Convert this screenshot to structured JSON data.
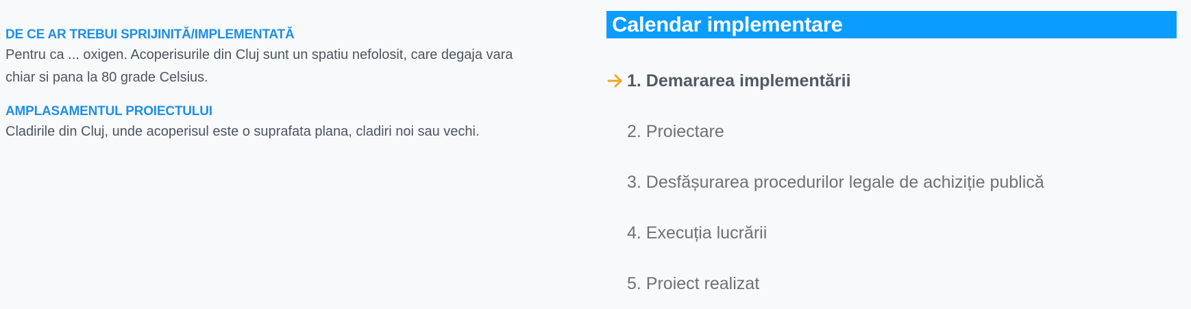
{
  "left": {
    "sections": [
      {
        "heading": "DE CE AR TREBUI SPRIJINITĂ/IMPLEMENTATĂ",
        "text_lines": [
          "Pentru ca ... oxigen. Acoperisurile din Cluj sunt un spatiu nefolosit, care degaja vara",
          "chiar si pana la 80 grade Celsius."
        ]
      },
      {
        "heading": "AMPLASAMENTUL PROIECTULUI",
        "text_lines": [
          "Cladirile din Cluj, unde acoperisul este o suprafata plana, cladiri noi sau vechi."
        ]
      }
    ]
  },
  "calendar": {
    "title": "Calendar implementare",
    "active_icon": "arrow-right-icon",
    "accent_color": "#f5a623",
    "title_bg_color": "#0a9cff",
    "steps": [
      {
        "label": "1. Demararea implementării",
        "active": true
      },
      {
        "label": "2. Proiectare",
        "active": false
      },
      {
        "label": "3. Desfășurarea procedurilor legale de achiziție publică",
        "active": false
      },
      {
        "label": "4. Execuția lucrării",
        "active": false
      },
      {
        "label": "5. Proiect realizat",
        "active": false
      }
    ]
  }
}
